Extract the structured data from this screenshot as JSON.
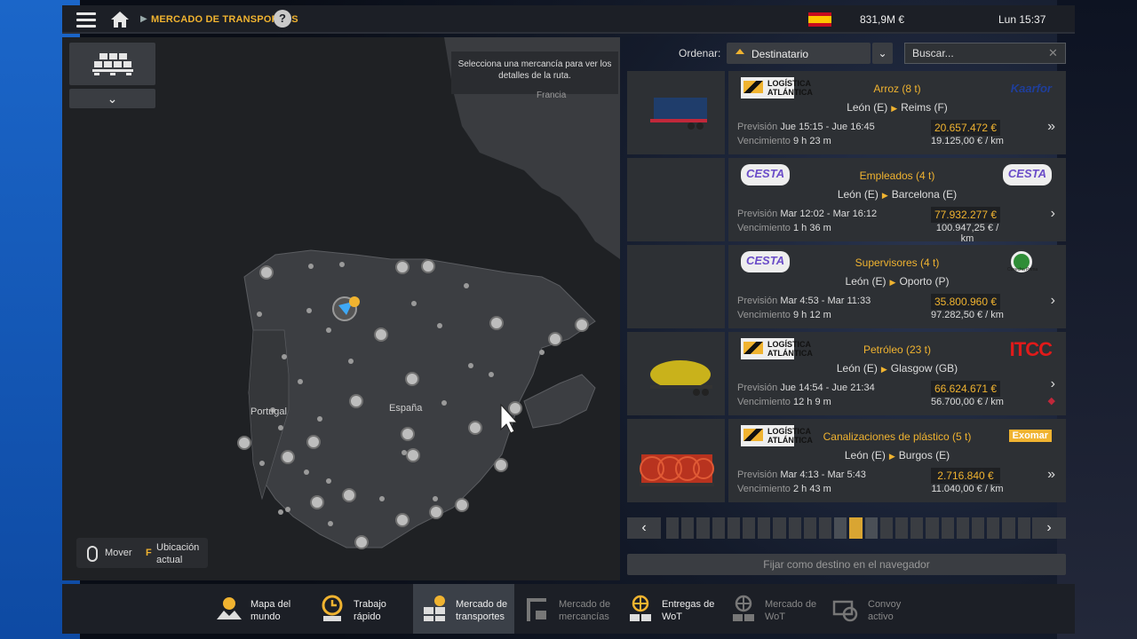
{
  "header": {
    "breadcrumb": "MERCADO DE TRANSPORTES",
    "help": "?",
    "money": "831,9M  €",
    "clock": "Lun 15:37"
  },
  "map": {
    "hint": "Selecciona una mercancía para ver los detalles de la ruta.",
    "labels": {
      "france": "Francia",
      "portugal": "Portugal",
      "spain": "España"
    },
    "legend": {
      "move": "Mover",
      "key": "F",
      "location": "Ubicación actual"
    }
  },
  "sort": {
    "label": "Ordenar:",
    "value": "Destinatario"
  },
  "search": {
    "placeholder": "Buscar..."
  },
  "jobs": [
    {
      "cargo": "Arroz (8 t)",
      "from": "León (E)",
      "to": "Reims (F)",
      "forecast_label": "Previsión",
      "forecast": "Jue 15:15 - Jue 16:45",
      "expiry_label": "Vencimiento",
      "expiry": "9 h 23 m",
      "price": "20.657.472 €",
      "per_km": "19.125,00 € / km",
      "speed": "»",
      "src_logo": "LOGÍSTICA ATLÁNTICA",
      "dst_logo": "Kaarfor"
    },
    {
      "cargo": "Empleados (4 t)",
      "from": "León (E)",
      "to": "Barcelona (E)",
      "forecast_label": "Previsión",
      "forecast": "Mar 12:02 - Mar 16:12",
      "expiry_label": "Vencimiento",
      "expiry": "1 h 36 m",
      "price": "77.932.277 €",
      "per_km": "100.947,25 € / km",
      "speed": "›",
      "src_logo": "CESTA",
      "dst_logo": "CESTA"
    },
    {
      "cargo": "Supervisores (4 t)",
      "from": "León (E)",
      "to": "Oporto (P)",
      "forecast_label": "Previsión",
      "forecast": "Mar 4:53 - Mar 11:33",
      "expiry_label": "Vencimiento",
      "expiry": "9 h 12 m",
      "price": "35.800.960 €",
      "per_km": "97.282,50 € / km",
      "speed": "›",
      "src_logo": "CESTA",
      "dst_logo": "Cosecha Prima"
    },
    {
      "cargo": "Petróleo (23 t)",
      "from": "León (E)",
      "to": "Glasgow (GB)",
      "forecast_label": "Previsión",
      "forecast": "Jue 14:54 - Jue 21:34",
      "expiry_label": "Vencimiento",
      "expiry": "12 h 9 m",
      "price": "66.624.671 €",
      "per_km": "56.700,00 € / km",
      "speed": "›",
      "src_logo": "LOGÍSTICA ATLÁNTICA",
      "dst_logo": "ITCC"
    },
    {
      "cargo": "Canalizaciones de plástico (5 t)",
      "from": "León (E)",
      "to": "Burgos (E)",
      "forecast_label": "Previsión",
      "forecast": "Mar 4:13 - Mar 5:43",
      "expiry_label": "Vencimiento",
      "expiry": "2 h 43 m",
      "price": "2.716.840 €",
      "per_km": "11.040,00 € / km",
      "speed": "»",
      "src_logo": "LOGÍSTICA ATLÁNTICA",
      "dst_logo": "Exomar"
    }
  ],
  "pager": {
    "prev": "‹",
    "next": "›",
    "total_pages": 24,
    "current_page": 13
  },
  "set_destination": "Fijar como destino en el navegador",
  "tabs": [
    {
      "label": "Mapa del mundo"
    },
    {
      "label": "Trabajo rápido"
    },
    {
      "label": "Mercado de transportes"
    },
    {
      "label": "Mercado de mercancías"
    },
    {
      "label": "Entregas de WoT"
    },
    {
      "label": "Mercado de WoT"
    },
    {
      "label": "Convoy activo"
    }
  ],
  "colors": {
    "accent": "#f0b330",
    "panel": "#2d3034",
    "danger": "#c0283a"
  }
}
